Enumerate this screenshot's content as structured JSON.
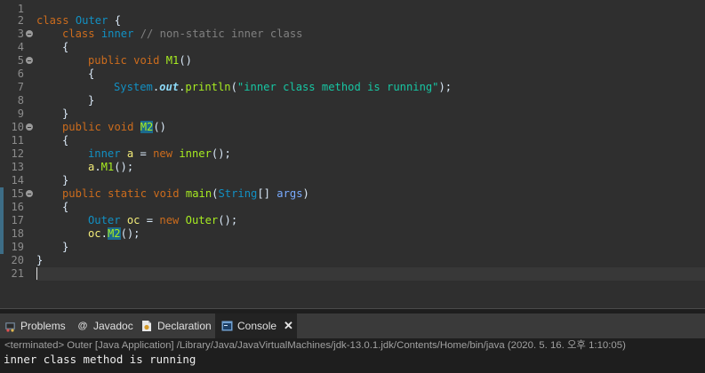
{
  "editor": {
    "line_numbers": [
      "1",
      "2",
      "3",
      "4",
      "5",
      "6",
      "7",
      "8",
      "9",
      "10",
      "11",
      "12",
      "13",
      "14",
      "15",
      "16",
      "17",
      "18",
      "19",
      "20",
      "21"
    ],
    "code": {
      "l2": {
        "kw": "class",
        "name": "Outer",
        "brace": "{"
      },
      "l3": {
        "kw": "class",
        "name": "inner",
        "comment": "// non-static inner class"
      },
      "l4": {
        "t": "{"
      },
      "l5": {
        "kw1": "public",
        "kw2": "void",
        "fn": "M1",
        "rest": "()"
      },
      "l6": {
        "t": "{"
      },
      "l7": {
        "cls": "System",
        "dot1": ".",
        "fld": "out",
        "dot2": ".",
        "fn": "println",
        "p1": "(",
        "str": "\"inner class method is running\"",
        "p2": ");"
      },
      "l8": {
        "t": "}"
      },
      "l9": {
        "t": "}"
      },
      "l10": {
        "kw1": "public",
        "kw2": "void",
        "fn": "M2",
        "rest": "()"
      },
      "l11": {
        "t": "{"
      },
      "l12": {
        "cls": "inner",
        "var": "a",
        "eq": "=",
        "kw": "new",
        "fn": "inner",
        "rest": "();"
      },
      "l13": {
        "var": "a",
        "dot": ".",
        "fn": "M1",
        "rest": "();"
      },
      "l14": {
        "t": "}"
      },
      "l15": {
        "kw1": "public",
        "kw2": "static",
        "kw3": "void",
        "fn": "main",
        "p1": "(",
        "cls": "String",
        "arr": "[]",
        "param": "args",
        "p2": ")"
      },
      "l16": {
        "t": "{"
      },
      "l17": {
        "cls": "Outer",
        "var": "oc",
        "eq": "=",
        "kw": "new",
        "fn": "Outer",
        "rest": "();"
      },
      "l18": {
        "var": "oc",
        "dot": ".",
        "fn": "M2",
        "rest": "();"
      },
      "l19": {
        "t": "}"
      },
      "l20": {
        "t": "}"
      }
    }
  },
  "tabs": [
    {
      "label": "Problems",
      "icon": "problems-icon"
    },
    {
      "label": "Javadoc",
      "icon": "javadoc-icon"
    },
    {
      "label": "Declaration",
      "icon": "declaration-icon"
    },
    {
      "label": "Console",
      "icon": "console-icon",
      "active": true,
      "close": "✕"
    }
  ],
  "console": {
    "status": "<terminated> Outer [Java Application] /Library/Java/JavaVirtualMachines/jdk-13.0.1.jdk/Contents/Home/bin/java (2020. 5. 16. 오후 1:10:05)",
    "output": "inner class method is running"
  },
  "colors": {
    "editor_bg": "#2f2f2f",
    "keyword": "#cc6c1d",
    "class": "#1290c3",
    "method": "#a7ec21",
    "string": "#17c6a3",
    "comment": "#808080",
    "local_var": "#f3ec79",
    "parameter": "#79abff",
    "occurrence_highlight": "#1c6a8c"
  }
}
